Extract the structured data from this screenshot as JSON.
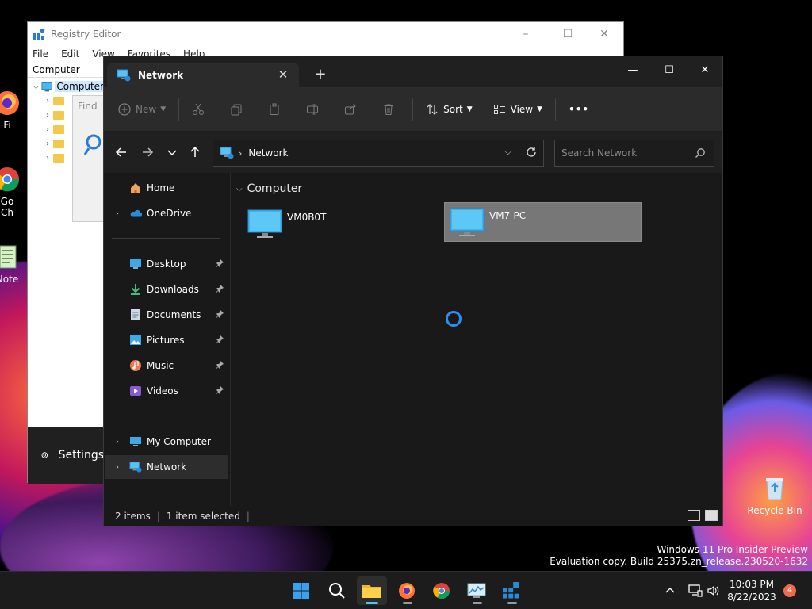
{
  "desktop": {
    "icons": [
      {
        "label": "Fi"
      },
      {
        "label": "Go\nCh"
      },
      {
        "label": "Note"
      },
      {
        "label": "Recycle Bin"
      }
    ],
    "watermark_line1": "Windows 11 Pro Insider Preview",
    "watermark_line2": "Evaluation copy. Build 25375.zn_release.230520-1632"
  },
  "regedit": {
    "title": "Registry Editor",
    "menu": [
      "File",
      "Edit",
      "View",
      "Favorites",
      "Help"
    ],
    "address": "Computer",
    "tree_root": "Computer",
    "find_label": "Find",
    "settings_label": "Settings"
  },
  "explorer": {
    "tab_title": "Network",
    "toolbar": {
      "new_label": "New",
      "sort_label": "Sort",
      "view_label": "View",
      "more_label": "•••"
    },
    "address": {
      "location": "Network"
    },
    "search": {
      "placeholder": "Search Network"
    },
    "sidebar": {
      "home": "Home",
      "onedrive": "OneDrive",
      "quick": [
        "Desktop",
        "Downloads",
        "Documents",
        "Pictures",
        "Music",
        "Videos"
      ],
      "my_computer": "My Computer",
      "network": "Network"
    },
    "content": {
      "group_title": "Computer",
      "items": [
        {
          "name": "VM0B0T",
          "selected": false
        },
        {
          "name": "VM7-PC",
          "selected": true
        }
      ]
    },
    "status": {
      "count": "2 items",
      "selection": "1 item selected"
    }
  },
  "taskbar": {
    "time": "10:03 PM",
    "date": "8/22/2023",
    "notification_count": "4"
  },
  "colors": {
    "accent": "#4cc2ff",
    "explorer_bg": "#191919",
    "toolbar_bg": "#2b2b2b",
    "selection": "#777777",
    "spinner": "#2f8cf0",
    "badge": "#ef6950"
  }
}
